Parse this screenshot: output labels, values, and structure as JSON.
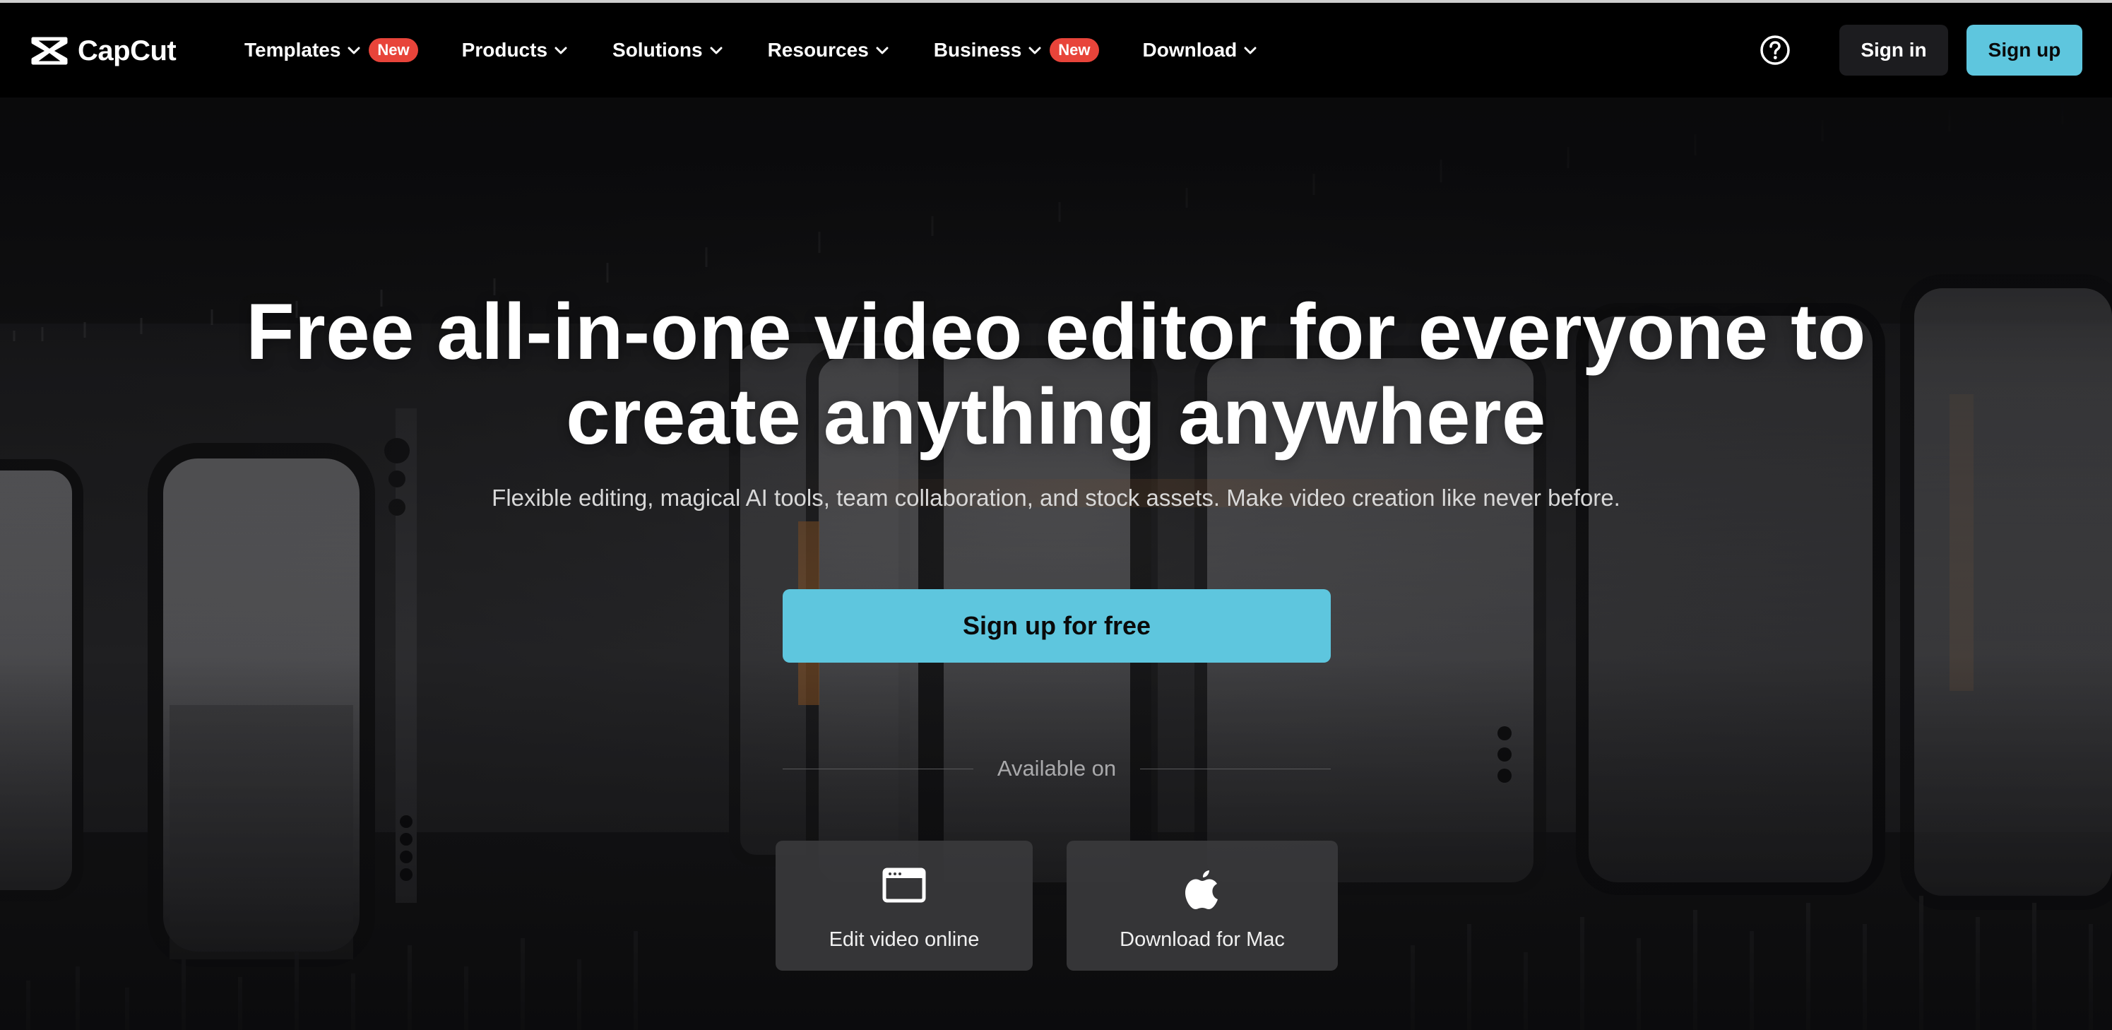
{
  "brand": {
    "name": "CapCut"
  },
  "nav": {
    "items": [
      {
        "label": "Templates",
        "badge": "New"
      },
      {
        "label": "Products",
        "badge": null
      },
      {
        "label": "Solutions",
        "badge": null
      },
      {
        "label": "Resources",
        "badge": null
      },
      {
        "label": "Business",
        "badge": "New"
      },
      {
        "label": "Download",
        "badge": null
      }
    ],
    "sign_in": "Sign in",
    "sign_up": "Sign up"
  },
  "hero": {
    "title_line1": "Free all-in-one video editor for everyone to",
    "title_line2": "create anything anywhere",
    "subtitle": "Flexible editing, magical AI tools, team collaboration, and stock assets. Make video creation like never before.",
    "cta": "Sign up for free",
    "available_on": "Available on",
    "platforms": [
      {
        "label": "Edit video online",
        "icon": "browser-window-icon"
      },
      {
        "label": "Download for Mac",
        "icon": "apple-icon"
      }
    ]
  },
  "colors": {
    "accent": "#5ec6de",
    "badge": "#e8443a",
    "nav_bg": "#000000",
    "button_dark": "#1c1c1f"
  }
}
